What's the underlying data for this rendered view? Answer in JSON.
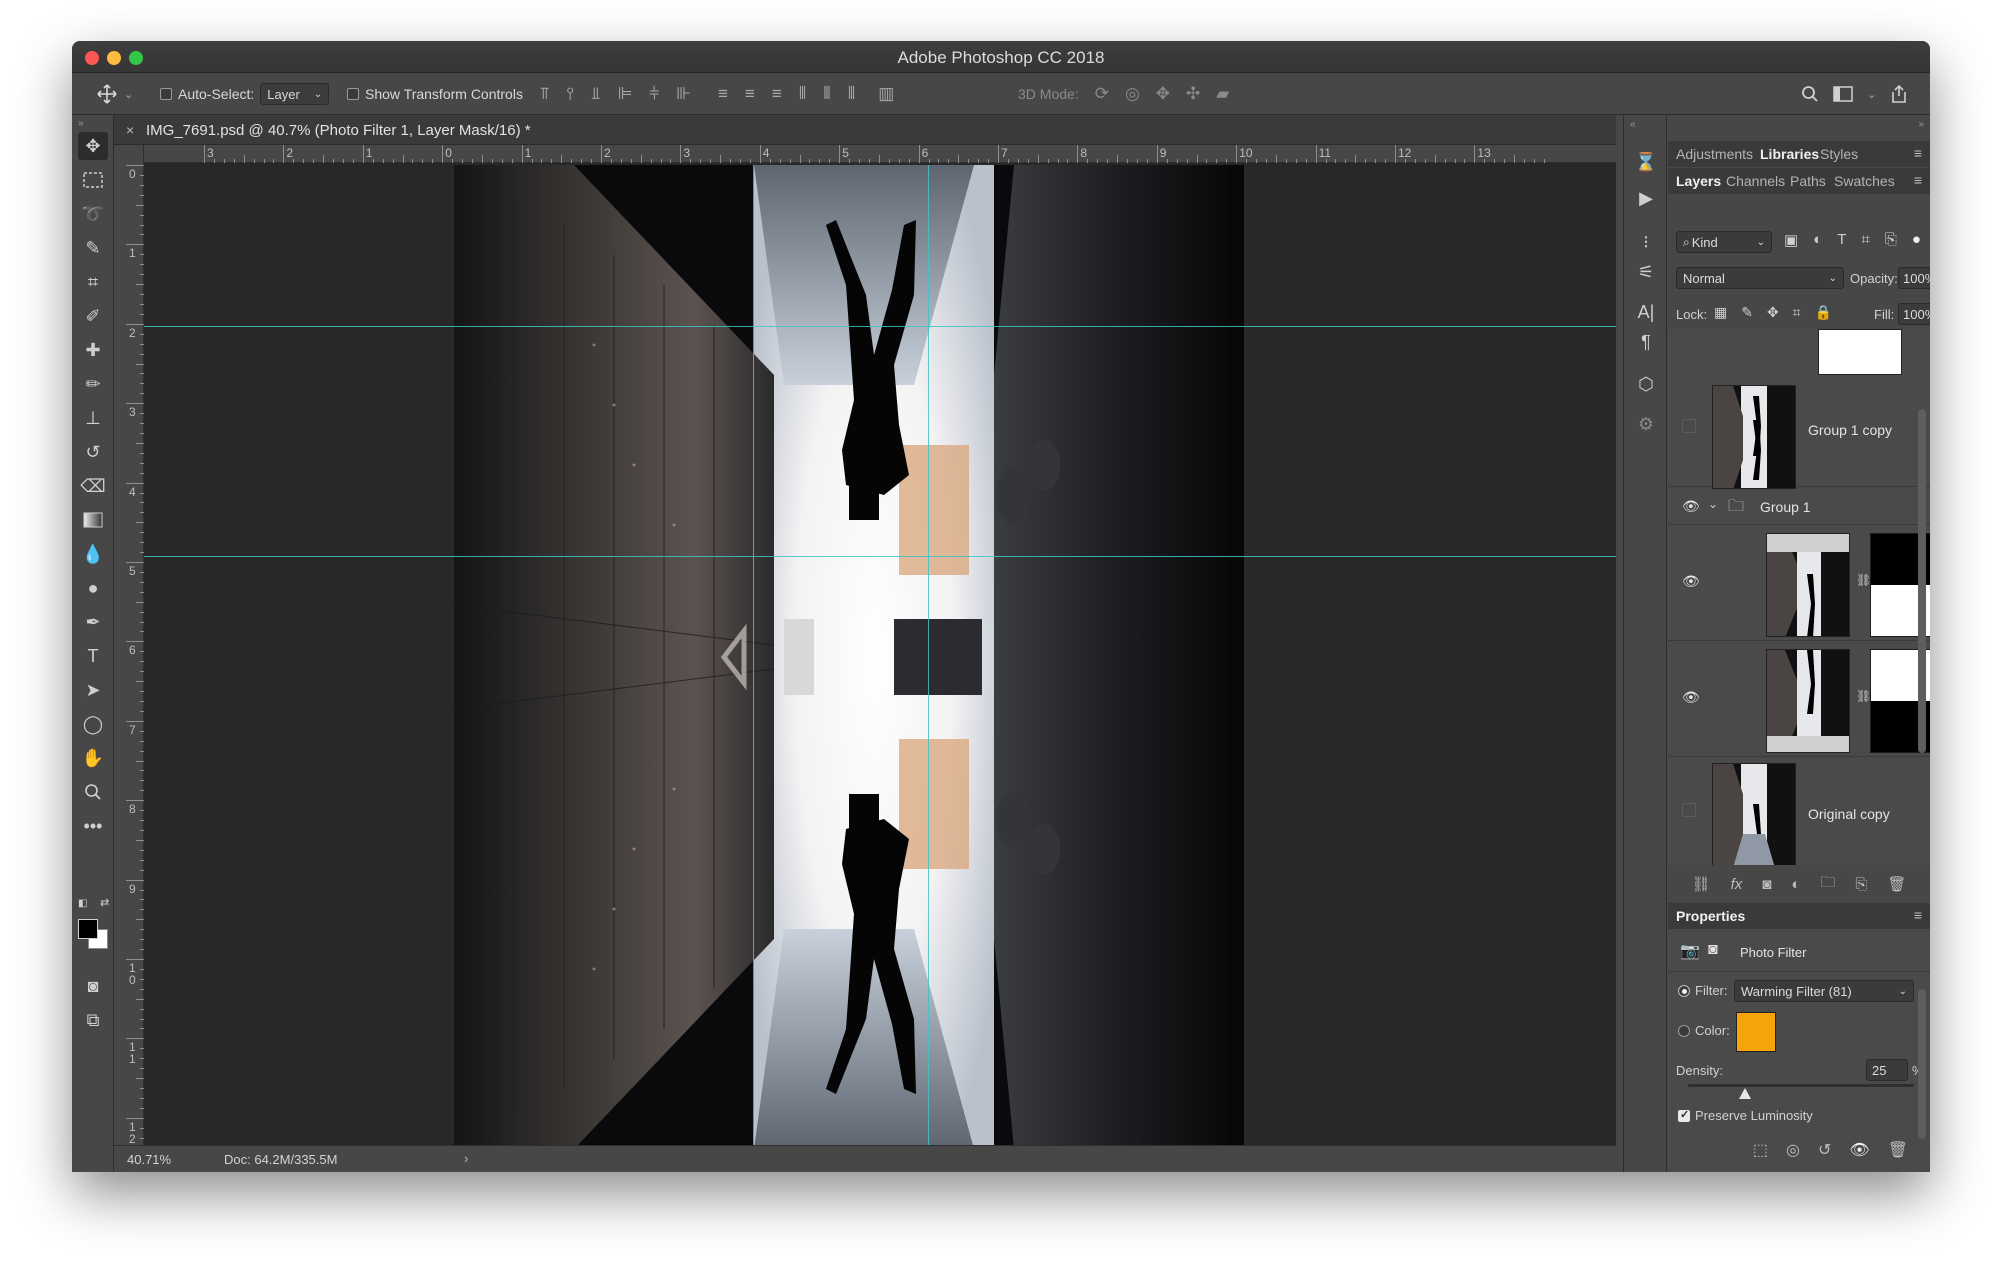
{
  "app": {
    "title": "Adobe Photoshop CC 2018"
  },
  "options_bar": {
    "auto_select_label": "Auto-Select:",
    "auto_select_value": "Layer",
    "show_transform_label": "Show Transform Controls",
    "mode_3d_label": "3D Mode:"
  },
  "document": {
    "tab_title": "IMG_7691.psd @ 40.7% (Photo Filter 1, Layer Mask/16) *",
    "close_symbol": "×"
  },
  "ruler": {
    "horizontal": [
      "3",
      "2",
      "1",
      "0",
      "1",
      "2",
      "3",
      "4",
      "5",
      "6",
      "7",
      "8",
      "9",
      "10",
      "11",
      "12",
      "13"
    ],
    "vertical": [
      "0",
      "1",
      "2",
      "3",
      "4",
      "5",
      "6",
      "7",
      "8",
      "9",
      "1\n0",
      "1\n1",
      "1\n2"
    ]
  },
  "status": {
    "zoom": "40.71%",
    "doc_size": "Doc: 64.2M/335.5M"
  },
  "panels_top": {
    "tabs": [
      "Adjustments",
      "Libraries",
      "Styles"
    ],
    "active_tab": "Libraries"
  },
  "layers_panel": {
    "tabs": [
      "Layers",
      "Channels",
      "Paths",
      "Swatches"
    ],
    "active_tab": "Layers",
    "filter_kind": "Kind",
    "blend_mode": "Normal",
    "opacity_label": "Opacity:",
    "opacity_value": "100%",
    "lock_label": "Lock:",
    "fill_label": "Fill:",
    "fill_value": "100%",
    "layers": [
      {
        "name": "Group 1 copy",
        "visible": false,
        "type": "smart-thumbnail"
      },
      {
        "name": "Group 1",
        "visible": true,
        "type": "group",
        "expanded": true
      },
      {
        "name": "",
        "visible": true,
        "type": "adjustment-with-mask"
      },
      {
        "name": "",
        "visible": true,
        "type": "adjustment-with-mask"
      },
      {
        "name": "Original copy",
        "visible": false,
        "type": "smart-thumbnail"
      }
    ]
  },
  "properties_panel": {
    "title": "Properties",
    "header": "Photo Filter",
    "filter_label": "Filter:",
    "filter_value": "Warming Filter (81)",
    "color_label": "Color:",
    "color_value": "#f5a50a",
    "density_label": "Density:",
    "density_value": "25",
    "density_unit": "%",
    "density_fraction": 0.25,
    "preserve_luminosity_label": "Preserve Luminosity",
    "preserve_luminosity_checked": true
  }
}
